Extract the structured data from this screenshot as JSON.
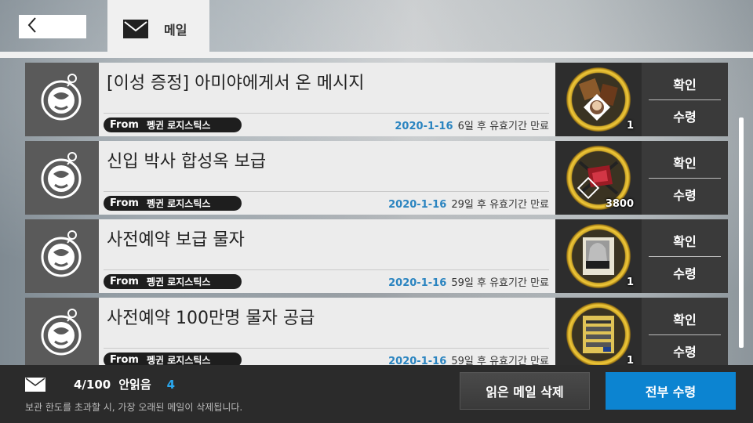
{
  "header": {
    "tab_label": "메일"
  },
  "mails": [
    {
      "title": "[이성 증정] 아미야에게서 온 메시지",
      "from_label": "From",
      "sender": "펭귄 로지스틱스",
      "date": "2020-1-16",
      "expire_text": "6일 후 유효기간 만료",
      "reward_icon": "furniture-reward-icon",
      "reward_count": "1",
      "confirm_label": "확인",
      "receive_label": "수령"
    },
    {
      "title": "신입 박사 합성옥 보급",
      "from_label": "From",
      "sender": "펭귄 로지스틱스",
      "date": "2020-1-16",
      "expire_text": "29일 후 유효기간 만료",
      "reward_icon": "originium-prime-icon",
      "reward_count": "3800",
      "confirm_label": "확인",
      "receive_label": "수령"
    },
    {
      "title": "사전예약 보급 물자",
      "from_label": "From",
      "sender": "펭귄 로지스틱스",
      "date": "2020-1-16",
      "expire_text": "59일 후 유효기간 만료",
      "reward_icon": "operator-card-icon",
      "reward_count": "1",
      "confirm_label": "확인",
      "receive_label": "수령"
    },
    {
      "title": "사전예약 100만명 물자 공급",
      "from_label": "From",
      "sender": "펭귄 로지스틱스",
      "date": "2020-1-16",
      "expire_text": "59일 후 유효기간 만료",
      "reward_icon": "supply-card-icon",
      "reward_count": "1",
      "confirm_label": "확인",
      "receive_label": "수령"
    }
  ],
  "footer": {
    "count": "4/100",
    "unread_label": "안읽음",
    "unread_count": "4",
    "note": "보관 한도를 초과할 시, 가장 오래된 메일이 삭제됩니다.",
    "delete_read_label": "읽은 메일 삭제",
    "receive_all_label": "전부 수령"
  },
  "colors": {
    "accent_blue": "#0c84d1",
    "date_blue": "#2a84c0",
    "unread_blue": "#2aa8ef",
    "reward_gold": "#f0c93a"
  }
}
